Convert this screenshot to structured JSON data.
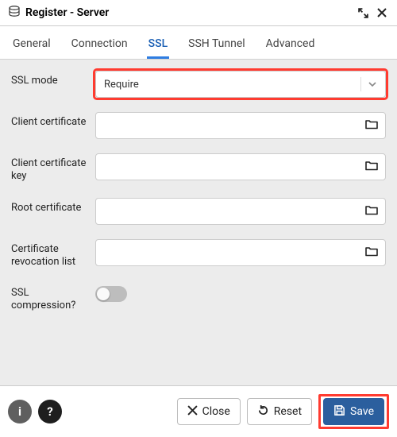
{
  "window": {
    "title": "Register - Server"
  },
  "tabs": {
    "items": [
      {
        "label": "General"
      },
      {
        "label": "Connection"
      },
      {
        "label": "SSL"
      },
      {
        "label": "SSH Tunnel"
      },
      {
        "label": "Advanced"
      }
    ],
    "activeIndex": 2
  },
  "form": {
    "ssl_mode": {
      "label": "SSL mode",
      "value": "Require"
    },
    "client_cert": {
      "label": "Client certificate",
      "value": ""
    },
    "client_cert_key": {
      "label": "Client certificate key",
      "value": ""
    },
    "root_cert": {
      "label": "Root certificate",
      "value": ""
    },
    "crl": {
      "label": "Certificate revocation list",
      "value": ""
    },
    "ssl_compression": {
      "label": "SSL compression?",
      "value": false
    }
  },
  "footer": {
    "close": "Close",
    "reset": "Reset",
    "save": "Save"
  }
}
